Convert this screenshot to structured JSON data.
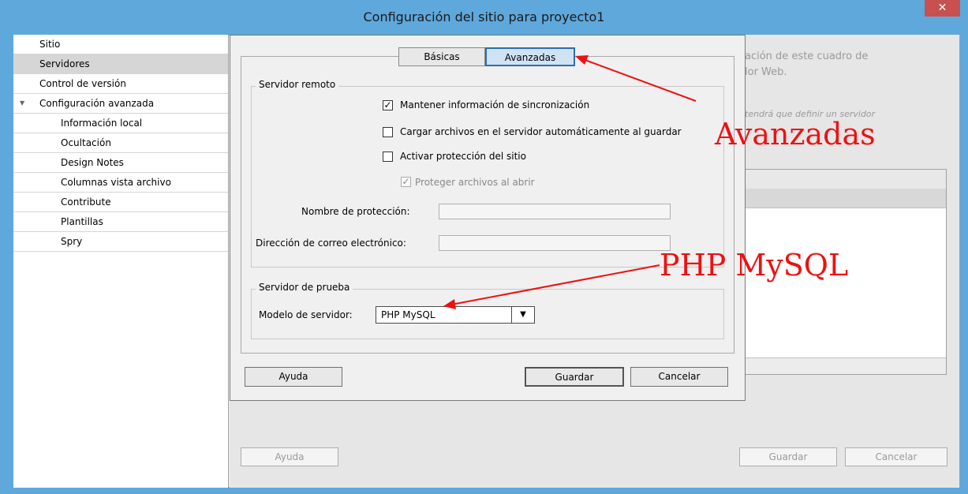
{
  "window": {
    "title": "Configuración del sitio para proyecto1",
    "close_glyph": "✕"
  },
  "sidebar": {
    "items": [
      {
        "label": "Sitio"
      },
      {
        "label": "Servidores"
      },
      {
        "label": "Control de versión"
      },
      {
        "label": "Configuración avanzada"
      },
      {
        "label": "Información local"
      },
      {
        "label": "Ocultación"
      },
      {
        "label": "Design Notes"
      },
      {
        "label": "Columnas vista archivo"
      },
      {
        "label": "Contribute"
      },
      {
        "label": "Plantillas"
      },
      {
        "label": "Spry"
      }
    ],
    "selected": "Servidores"
  },
  "background": {
    "text1": "ación de este cuadro de",
    "text2": "lor Web.",
    "italic": "tendrá que definir un servidor",
    "help_label": "Ayuda",
    "save_label": "Guardar",
    "cancel_label": "Cancelar"
  },
  "dialog": {
    "tabs": [
      {
        "label": "Básicas"
      },
      {
        "label": "Avanzadas"
      }
    ],
    "active_tab": "Avanzadas",
    "remote_group": {
      "title": "Servidor remoto",
      "sync": {
        "label": "Mantener información de sincronización",
        "checked": true
      },
      "autoupload": {
        "label": "Cargar archivos en el servidor automáticamente al guardar",
        "checked": false
      },
      "protect": {
        "label": "Activar protección del sitio",
        "checked": false
      },
      "protect_open": {
        "label": "Proteger archivos al abrir",
        "checked": true,
        "disabled": true
      },
      "protect_name_label": "Nombre de protección:",
      "protect_name_value": "",
      "email_label": "Dirección de correo electrónico:",
      "email_value": ""
    },
    "test_group": {
      "title": "Servidor de prueba",
      "model_label": "Modelo de servidor:",
      "model_value": "PHP MySQL"
    },
    "buttons": {
      "help": "Ayuda",
      "save": "Guardar",
      "cancel": "Cancelar"
    }
  },
  "annotations": {
    "avanzadas": "Avanzadas",
    "php_mysql": "PHP MySQL",
    "color": "#ee1111"
  },
  "icons": {
    "checkmark": "☑",
    "tree_toggle": "▼",
    "dropdown_arrow": "▼"
  }
}
